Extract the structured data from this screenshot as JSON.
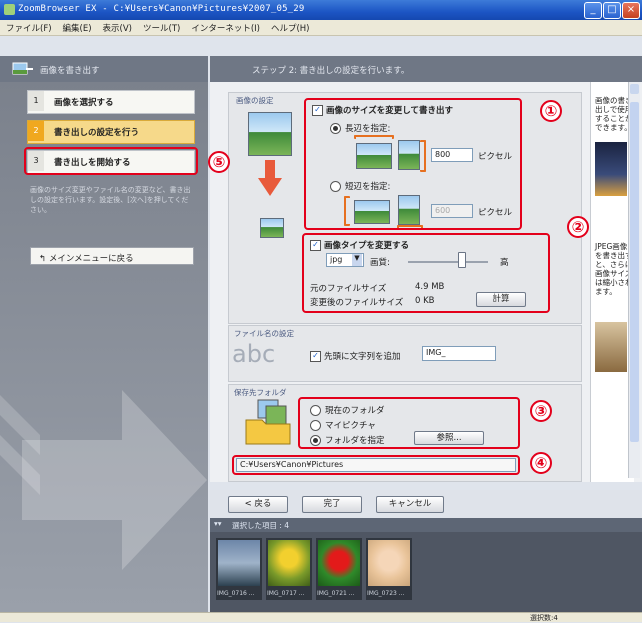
{
  "window": {
    "title": "ZoomBrowser EX - C:¥Users¥Canon¥Pictures¥2007_05_29",
    "controls": [
      "_",
      "□",
      "×"
    ]
  },
  "menu": [
    "ファイル(F)",
    "編集(E)",
    "表示(V)",
    "ツール(T)",
    "インターネット(I)",
    "ヘルプ(H)"
  ],
  "left": {
    "header": "画像を書き出す",
    "steps": [
      {
        "num": "1",
        "label": "画像を選択する"
      },
      {
        "num": "2",
        "label": "書き出しの設定を行う"
      },
      {
        "num": "3",
        "label": "書き出しを開始する"
      }
    ],
    "description": "画像のサイズ変更やファイル名の変更など、書き出しの設定を行います。設定後、[次へ]を押してください。",
    "back_menu": "メインメニューに戻る"
  },
  "main": {
    "header": "ステップ 2: 書き出しの設定を行います。",
    "image_settings": {
      "section_label": "画像の設定",
      "resize_checkbox": "画像のサイズを変更して書き出す",
      "long_side_radio": "長辺を指定:",
      "long_side_value": "800",
      "pixels_unit": "ピクセル",
      "short_side_radio": "短辺を指定:",
      "short_side_value": "600",
      "pixels_unit2": "ピクセル",
      "type_checkbox": "画像タイプを変更する",
      "type_value": "jpg",
      "quality_label": "画質:",
      "quality_high": "高",
      "orig_size_label": "元のファイルサイズ",
      "orig_size_value": "4.9 MB",
      "new_size_label": "変更後のファイルサイズ",
      "new_size_value": "0 KB",
      "calc_button": "計算"
    },
    "filename": {
      "section_label": "ファイル名の設定",
      "sample": "abc",
      "prefix_checkbox": "先頭に文字列を追加",
      "prefix_value": "IMG_"
    },
    "destination": {
      "section_label": "保存先フォルダ",
      "options": [
        "現在のフォルダ",
        "マイピクチャ",
        "フォルダを指定"
      ],
      "browse_button": "参照...",
      "path": "C:¥Users¥Canon¥Pictures"
    },
    "side_info": {
      "text1": "画像の書き出しで使用することができます。",
      "text2": "JPEG画像を書き出すと、さらに画像サイズは縮小されます。"
    }
  },
  "buttons": {
    "back": "< 戻る",
    "done": "完了",
    "cancel": "キャンセル"
  },
  "thumbs": {
    "header": "選択した項目 : 4",
    "items": [
      "IMG_0716 ...",
      "IMG_0717 ...",
      "IMG_0721 ...",
      "IMG_0723 ..."
    ]
  },
  "status": {
    "count": "選択数:4"
  },
  "callouts": [
    "①",
    "②",
    "③",
    "④",
    "⑤"
  ],
  "colors": {
    "highlight": "#e3001b",
    "active_step": "#f0a81f",
    "titlebar": "#1c55c4"
  }
}
